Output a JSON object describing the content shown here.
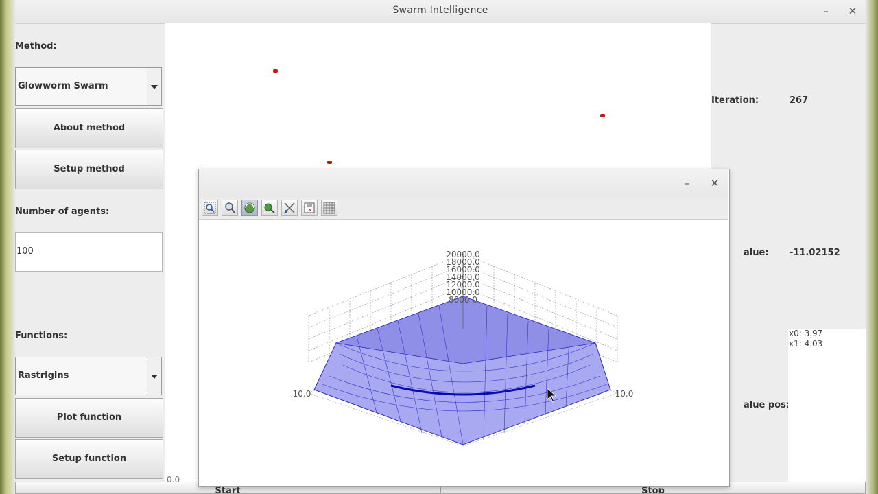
{
  "window": {
    "title": "Swarm Intelligence"
  },
  "left_panel": {
    "method_label": "Method:",
    "method_selected": "Glowworm Swarm",
    "about_method": "About method",
    "setup_method": "Setup method",
    "agents_label": "Number of agents:",
    "agents_value": "100",
    "functions_label": "Functions:",
    "function_selected": "Rastrigins",
    "plot_function": "Plot function",
    "setup_function": "Setup function"
  },
  "canvas": {
    "axis_zero": "0.0"
  },
  "right_panel": {
    "iteration_label": "Iteration:",
    "iteration_value": "267",
    "value_label": "alue:",
    "value_value": "-11.02152",
    "pos_label": "alue pos:",
    "pos_lines": [
      "x0: 3.97",
      "x1: 4.03"
    ]
  },
  "bottom": {
    "start": "Start",
    "stop": "Stop"
  },
  "plot_window": {
    "z_ticks": [
      "20000.0",
      "18000.0",
      "16000.0",
      "14000.0",
      "12000.0",
      "10000.0",
      "8000.0"
    ],
    "x_left_label": "10.0",
    "x_right_label": "10.0",
    "tools": [
      "zoom-region-icon",
      "zoom-icon",
      "rotate-icon",
      "pan-icon",
      "axis-toggle-icon",
      "save-icon",
      "grid-icon"
    ]
  },
  "colors": {
    "surface": "#a8a8f0",
    "mesh": "#3030c8",
    "agent": "#d11010"
  }
}
